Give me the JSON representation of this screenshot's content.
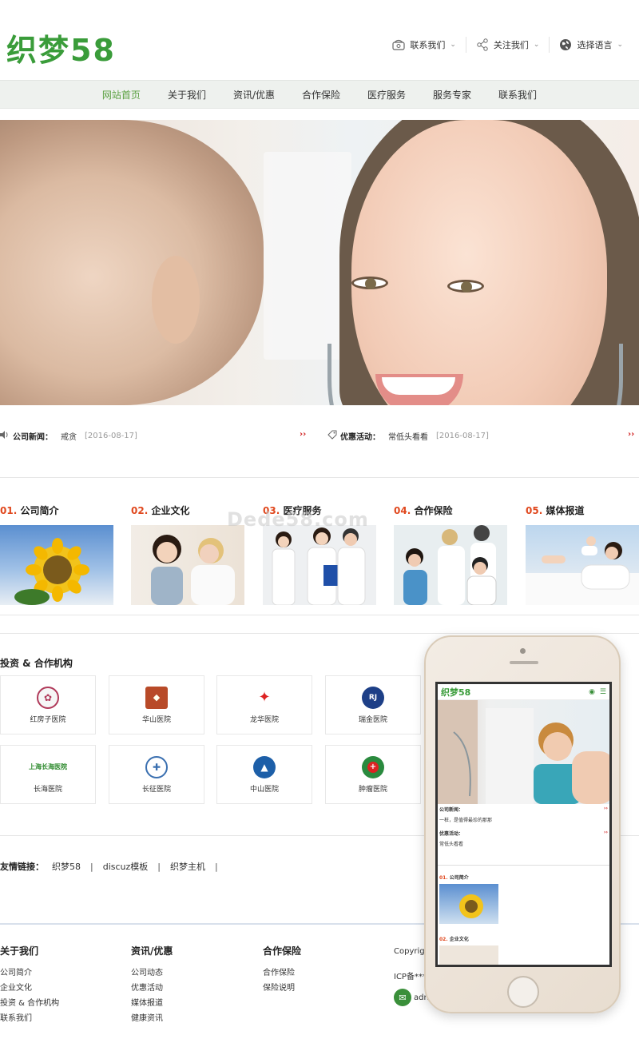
{
  "header": {
    "logo": "织梦58",
    "top_links": [
      {
        "label": "联系我们",
        "icon": "phone-icon"
      },
      {
        "label": "关注我们",
        "icon": "share-icon"
      },
      {
        "label": "选择语言",
        "icon": "globe-icon"
      }
    ]
  },
  "nav": {
    "items": [
      "网站首页",
      "关于我们",
      "资讯/优惠",
      "合作保险",
      "医疗服务",
      "服务专家",
      "联系我们"
    ],
    "active_index": 0
  },
  "banner": {
    "slide_count": 2,
    "active_slide": 1
  },
  "news": {
    "company_label": "公司新闻：",
    "company_title": "戒贪",
    "company_date": "[2016-08-17]",
    "promo_label": "优惠活动：",
    "promo_title": "常低头看看",
    "promo_date": "[2016-08-17]",
    "more": "››"
  },
  "watermark": "Dede58.com",
  "features": [
    {
      "num": "01.",
      "title": "公司简介"
    },
    {
      "num": "02.",
      "title": "企业文化"
    },
    {
      "num": "03.",
      "title": "医疗服务"
    },
    {
      "num": "04.",
      "title": "合作保险"
    },
    {
      "num": "05.",
      "title": "媒体报道"
    }
  ],
  "partners": {
    "title": "投资 & 合作机构",
    "items": [
      "红房子医院",
      "华山医院",
      "龙华医院",
      "瑞金医院",
      "长海医院",
      "长征医院",
      "中山医院",
      "肿瘤医院"
    ],
    "logo_text": [
      "",
      "",
      "",
      "RJ",
      "上海长海医院",
      "",
      "",
      ""
    ]
  },
  "links": {
    "label": "友情链接：",
    "items": [
      "织梦58",
      "discuz模板",
      "织梦主机"
    ],
    "separator": "|"
  },
  "footer": {
    "cols": [
      {
        "title": "关于我们",
        "items": [
          "公司简介",
          "企业文化",
          "投资 & 合作机构",
          "联系我们"
        ]
      },
      {
        "title": "资讯/优惠",
        "items": [
          "公司动态",
          "优惠活动",
          "媒体报道",
          "健康资讯"
        ]
      },
      {
        "title": "合作保险",
        "items": [
          "合作保险",
          "保险说明"
        ]
      }
    ],
    "copyright": "Copyright",
    "icp": "ICP备***",
    "email_prefix": "adm"
  },
  "phone": {
    "logo": "织梦58",
    "news_label": "公司新闻：",
    "news_text": "一桩，是值得最珍的那那",
    "promo_label": "优惠活动：",
    "promo_text": "常低头看看",
    "more": "››",
    "sections": [
      {
        "num": "01.",
        "title": "公司简介"
      },
      {
        "num": "02.",
        "title": "企业文化"
      }
    ]
  },
  "colors": {
    "brand_green": "#3a9c3a",
    "nav_active": "#5aa040",
    "accent_red": "#e0481e"
  }
}
